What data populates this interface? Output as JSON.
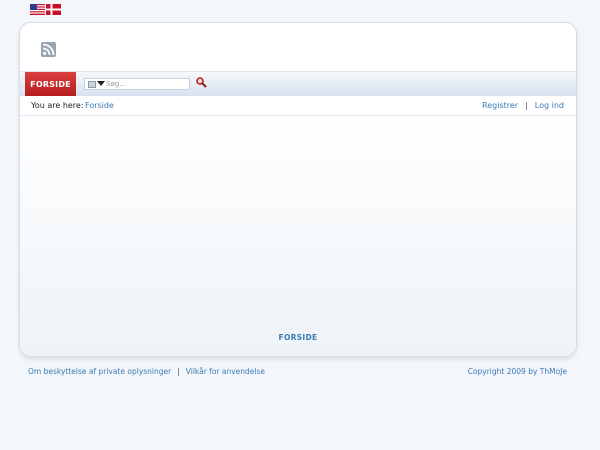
{
  "languages": [
    {
      "name": "us-flag-icon"
    },
    {
      "name": "dk-flag-icon"
    }
  ],
  "header": {
    "rss_icon": "rss-icon"
  },
  "nav": {
    "tab_label": "FORSIDE",
    "search": {
      "placeholder": "Søg...",
      "value": "",
      "search_button_icon": "magnifier-icon"
    }
  },
  "breadcrumb": {
    "label": "You are here:",
    "current": "Forside"
  },
  "user_links": {
    "register": "Registrer",
    "separator": "|",
    "login": "Log ind"
  },
  "content": {
    "bottom_link": "FORSIDE"
  },
  "footer": {
    "privacy": "Om beskyttelse af private oplysninger",
    "separator": "|",
    "terms": "Vilkår for anvendelse",
    "copyright": "Copyright 2009 by ThMoJe"
  },
  "colors": {
    "accent_red": "#c62828",
    "link_blue": "#3a7bb5"
  }
}
